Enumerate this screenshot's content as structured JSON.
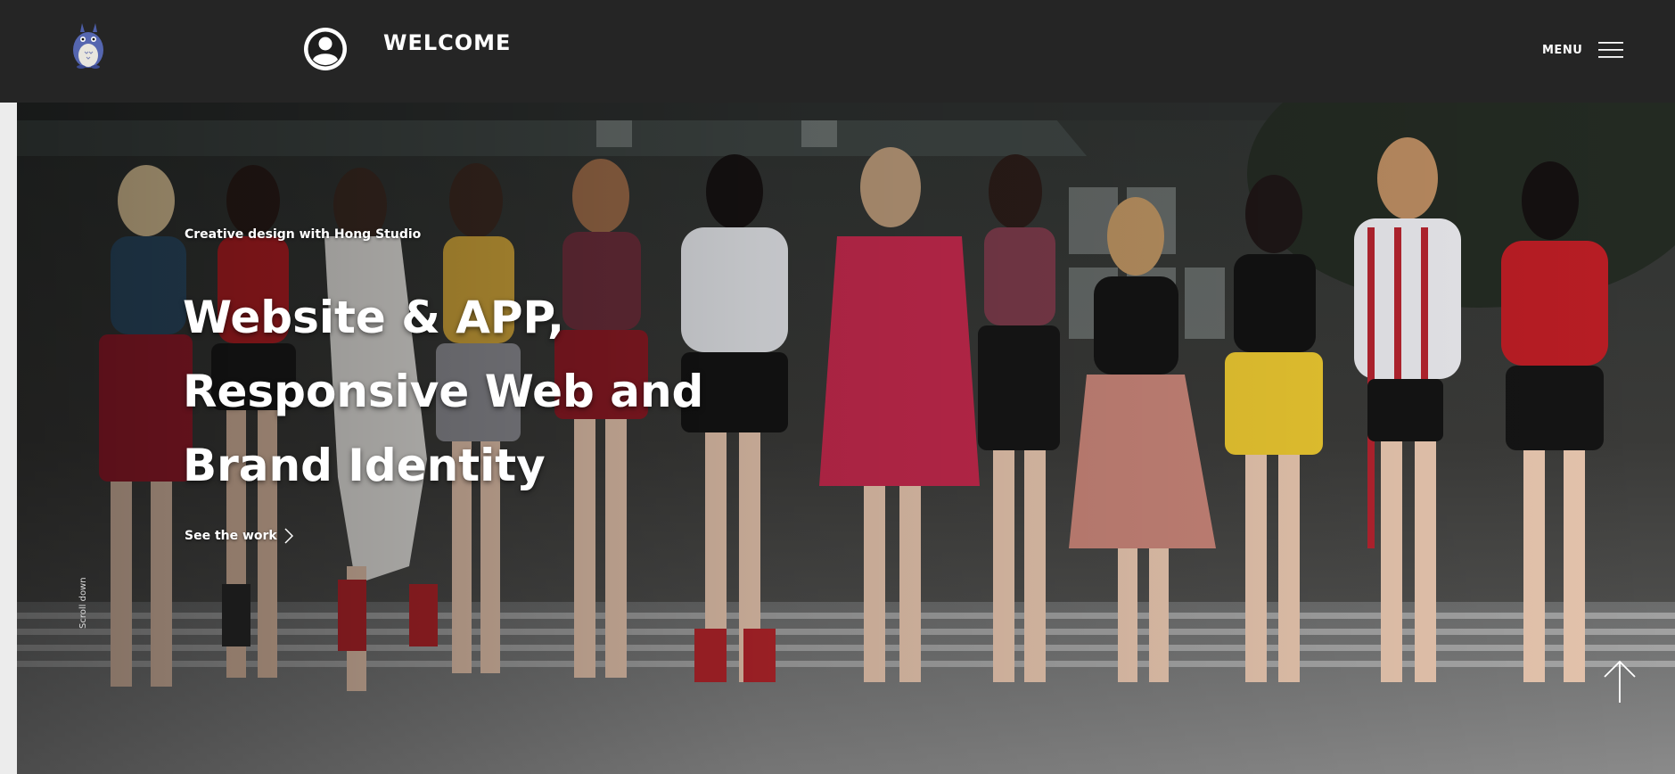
{
  "header": {
    "logo_icon": "totoro-mascot-icon",
    "account_icon": "user-circle-icon",
    "welcome_text": "WELCOME",
    "menu_label": "MENU",
    "menu_icon": "hamburger-icon",
    "background_color": "#252525"
  },
  "hero": {
    "eyebrow": "Creative design with Hong Studio",
    "headline_lines": [
      "Website & APP,",
      "Responsive Web and",
      "Brand Identity"
    ],
    "cta_label": "See the work",
    "cta_icon": "chevron-right-icon",
    "scroll_label": "Scroll down",
    "scroll_top_icon": "arrow-up-icon",
    "photo": "group-photo-image"
  }
}
